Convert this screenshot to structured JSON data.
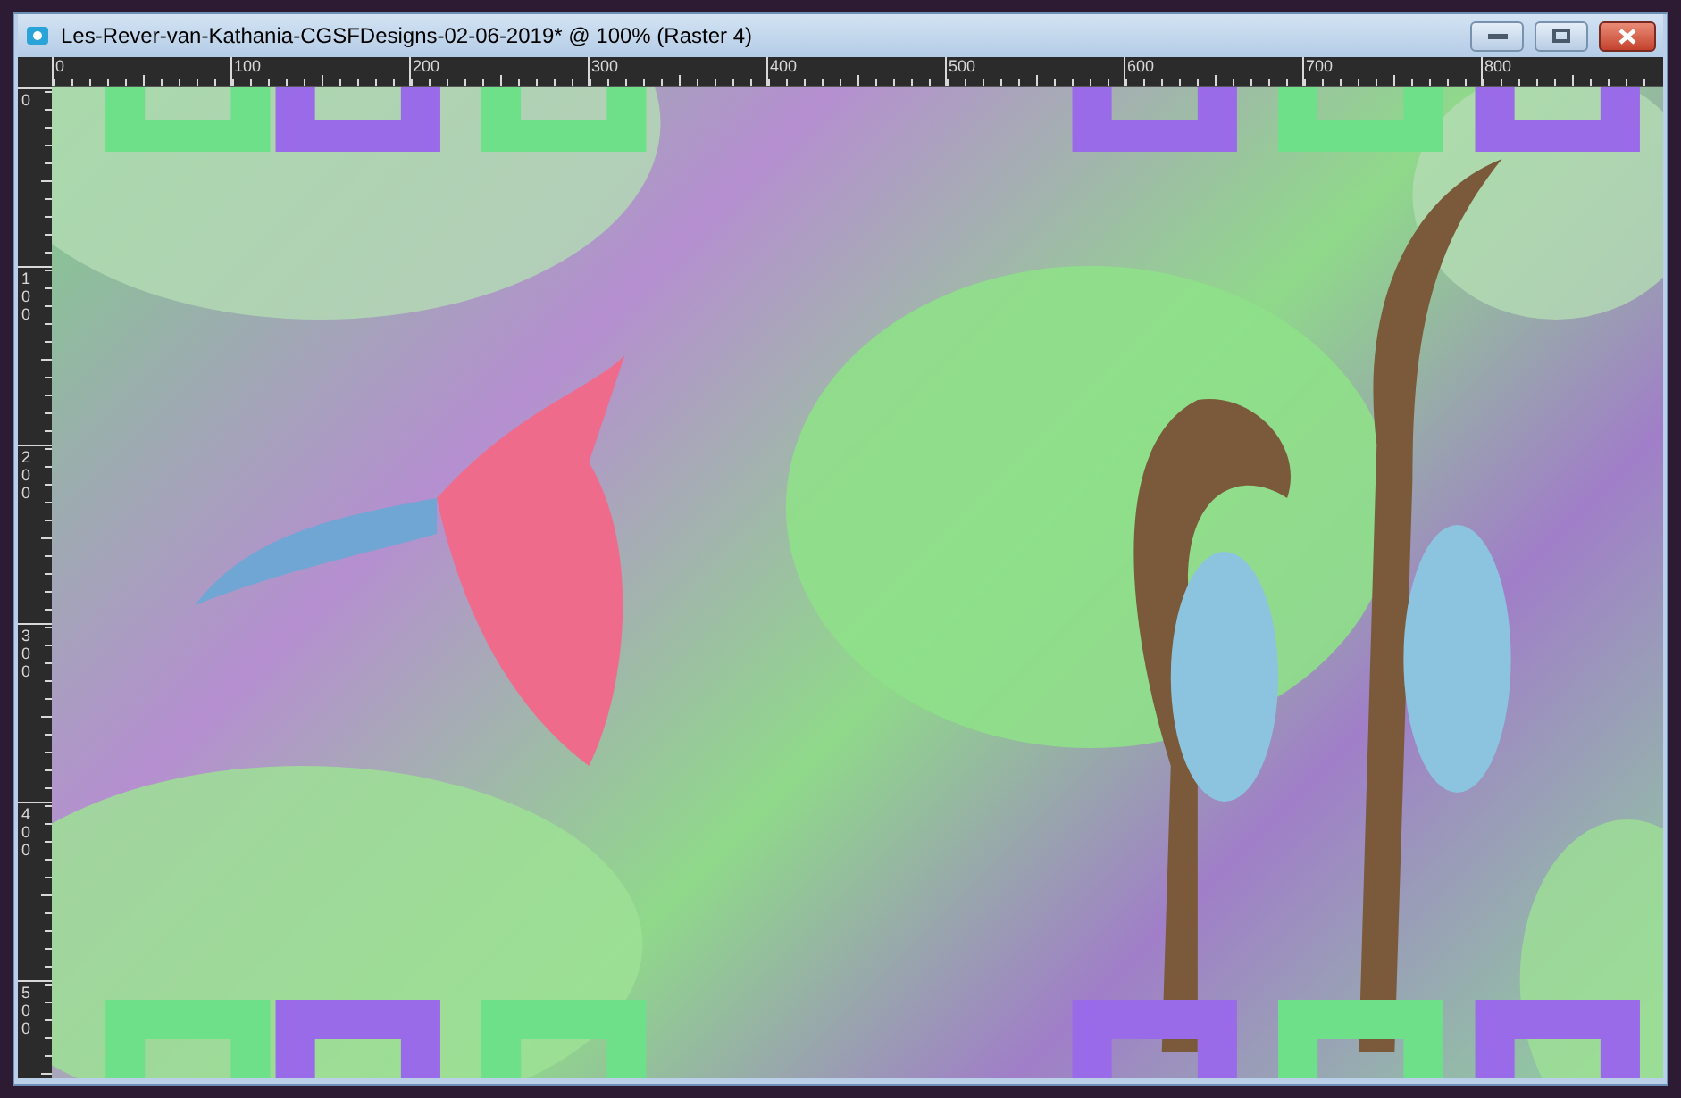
{
  "window": {
    "title": "Les-Rever-van-Kathania-CGSFDesigns-02-06-2019* @ 100% (Raster 4)"
  },
  "horizontal_ruler": {
    "labels": [
      "0",
      "100",
      "200",
      "300",
      "400",
      "500",
      "600",
      "700",
      "800"
    ]
  },
  "vertical_ruler": {
    "labels": [
      "0",
      "100",
      "200",
      "300",
      "400",
      "500"
    ]
  }
}
